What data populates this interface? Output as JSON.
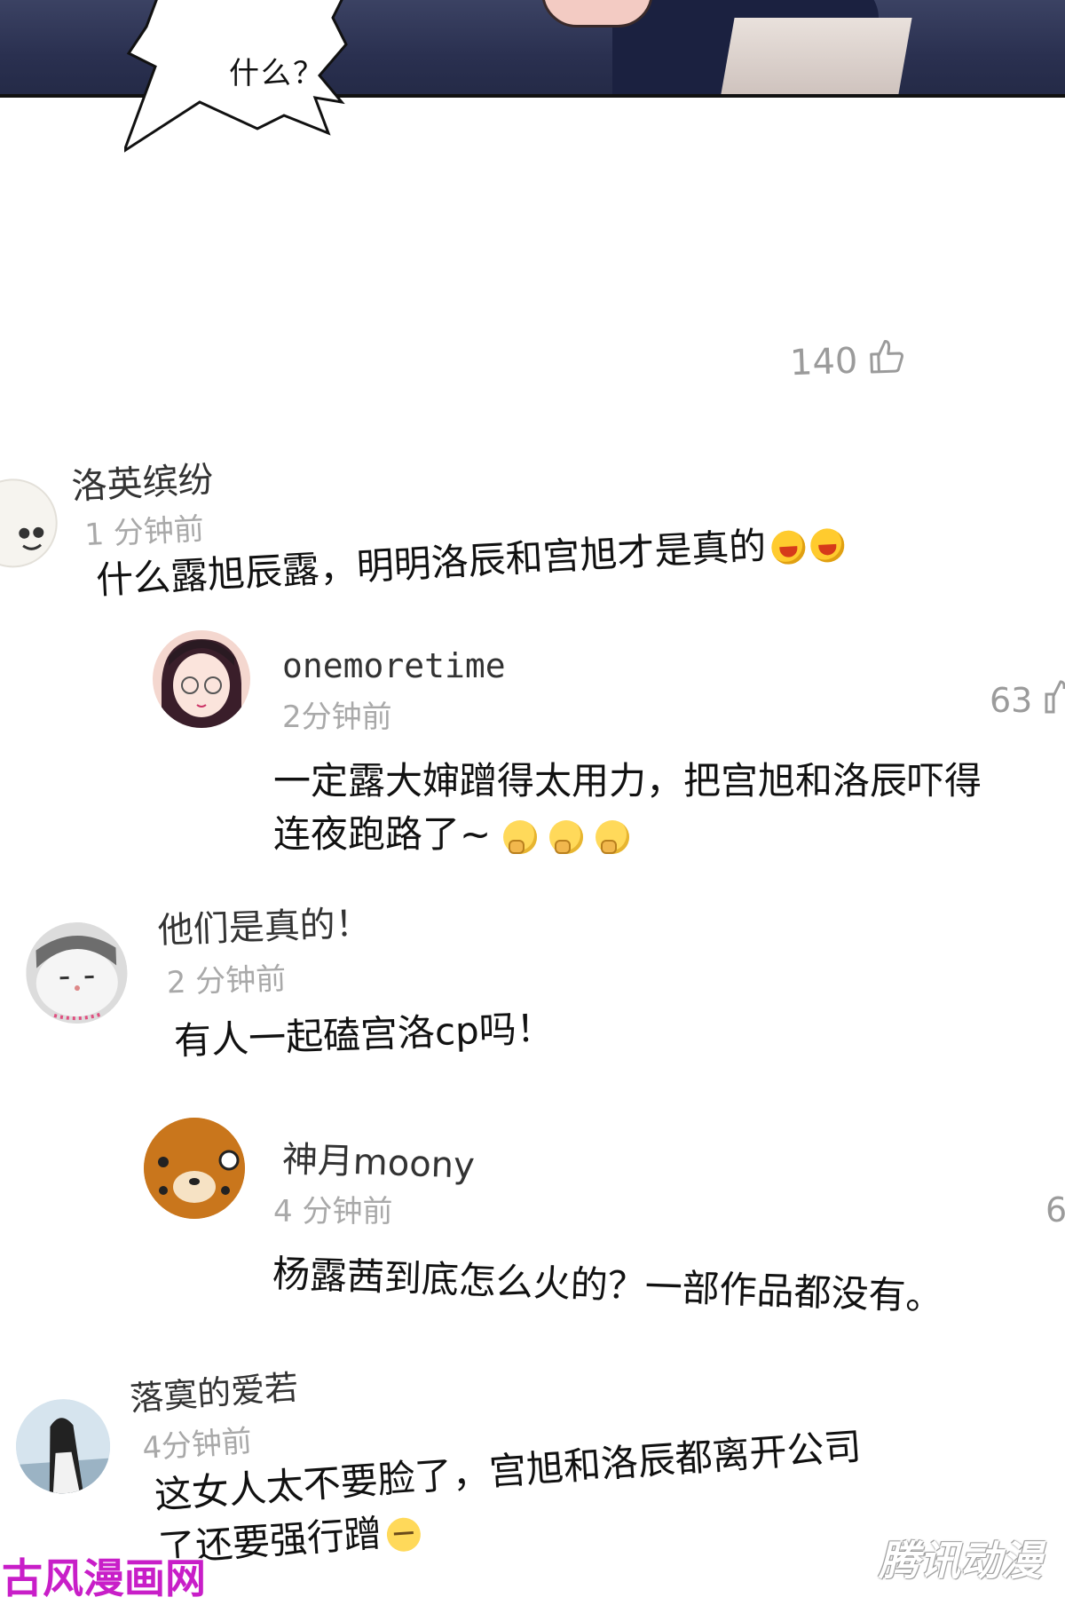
{
  "panel": {
    "bubble_text": "什么？"
  },
  "post_likes": "140",
  "comments": [
    {
      "user": "洛英缤纷",
      "time": "1 分钟前",
      "text": "什么露旭辰露，明明洛辰和宫旭才是真的",
      "emojis": [
        "laugh-emoji",
        "laugh-emoji"
      ]
    },
    {
      "user": "onemoretime",
      "time": "2分钟前",
      "likes": "63",
      "text_line1": "一定露大婶蹭得太用力，把宫旭和洛辰吓得",
      "text_line2": "连夜跑路了~",
      "emojis": [
        "thinking-emoji",
        "thinking-emoji",
        "thinking-emoji"
      ]
    },
    {
      "user": "他们是真的！",
      "time": "2 分钟前",
      "text": "有人一起磕宫洛cp吗！"
    },
    {
      "user": "神月moony",
      "time": "4 分钟前",
      "likes_partial": "6",
      "text": "杨露茜到底怎么火的？一部作品都没有。"
    },
    {
      "user": "落寞的爱若",
      "time": "4分钟前",
      "text_line1": "这女人太不要脸了，宫旭和洛辰都离开公司",
      "text_line2": "了还要强行蹭",
      "emojis": [
        "sleepy-emoji"
      ]
    }
  ],
  "watermarks": {
    "left": "古风漫画网",
    "right": "腾讯动漫"
  },
  "colors": {
    "panel_bg": "#2a3050",
    "muted_text": "#a9a9a9",
    "watermark_left": "#c81ec8"
  }
}
